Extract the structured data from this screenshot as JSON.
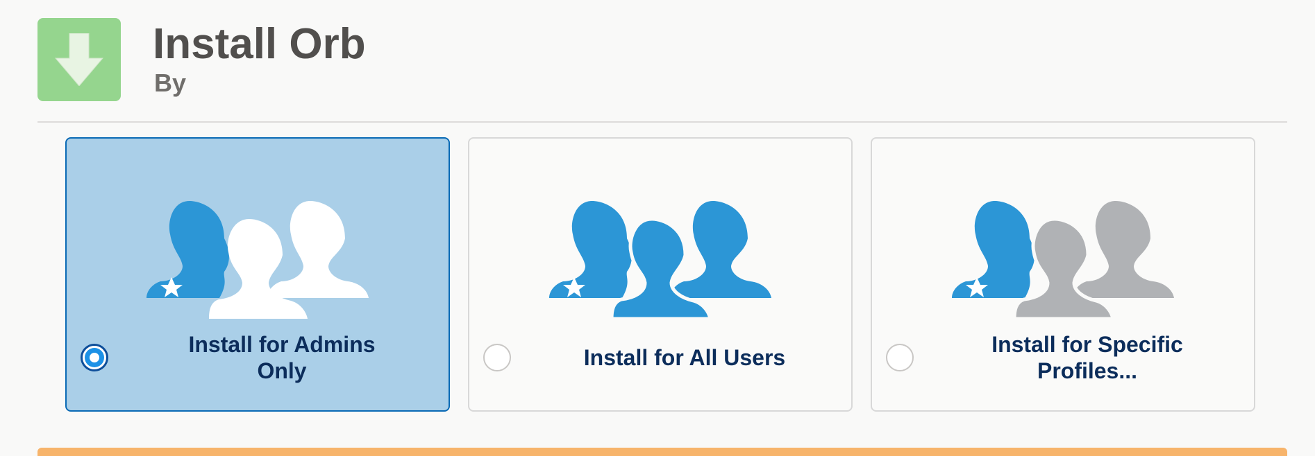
{
  "header": {
    "title": "Install Orb",
    "subtitle": "By"
  },
  "icons": {
    "app": "download-arrow-icon",
    "admin": "admin-user-icon",
    "users": "users-group-icon"
  },
  "colors": {
    "app_icon_bg": "#95d58e",
    "selected_card_bg": "#aacfe8",
    "selected_card_border": "#0a6ab5",
    "icon_blue": "#2c96d6",
    "icon_gray": "#b0b2b5",
    "label_navy": "#0c2d5b",
    "warning_orange": "#f7b46b"
  },
  "options": [
    {
      "label": "Install for Admins Only",
      "selected": true,
      "art": "admin-with-white-users"
    },
    {
      "label": "Install for All Users",
      "selected": false,
      "art": "all-blue-users"
    },
    {
      "label": "Install for Specific Profiles...",
      "selected": false,
      "art": "admin-with-gray-users"
    }
  ]
}
